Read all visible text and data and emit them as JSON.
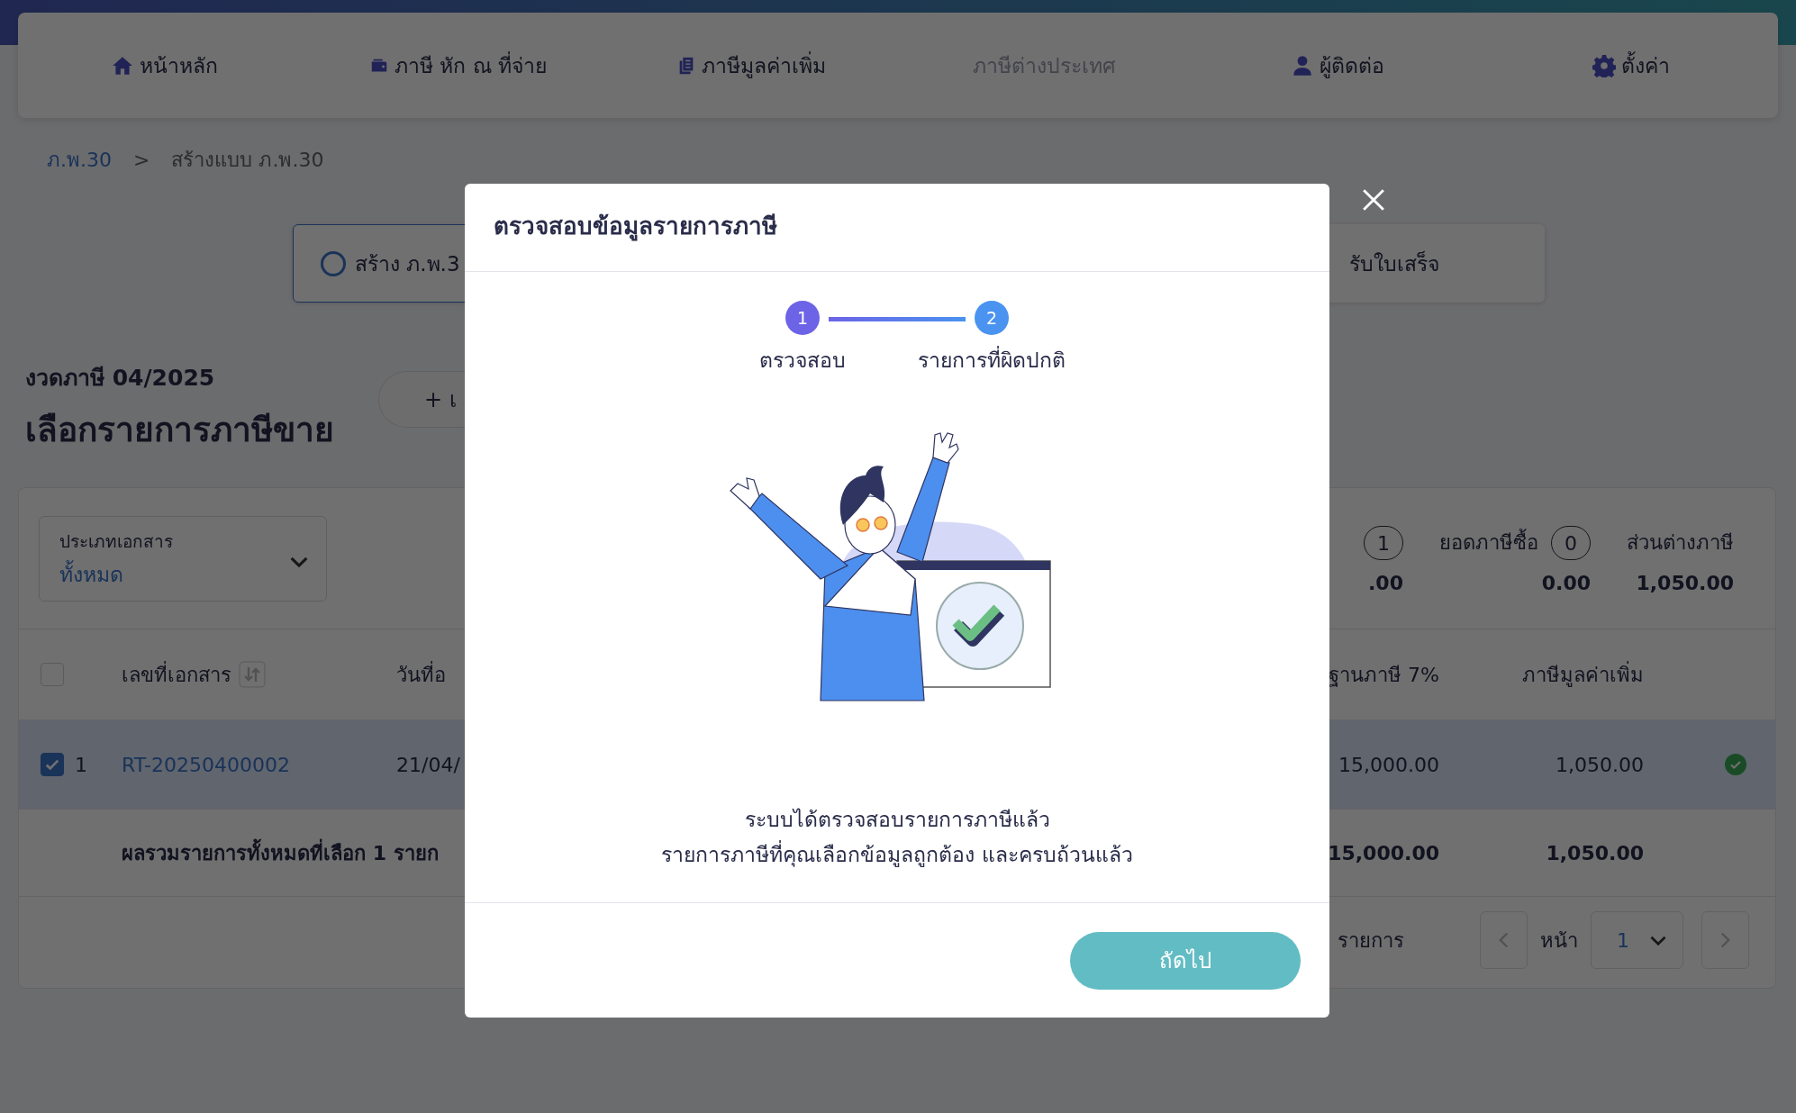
{
  "nav": [
    {
      "label": "หน้าหลัก",
      "disabled": false
    },
    {
      "label": "ภาษี หัก ณ ที่จ่าย",
      "disabled": false
    },
    {
      "label": "ภาษีมูลค่าเพิ่ม",
      "disabled": false
    },
    {
      "label": "ภาษีต่างประเทศ",
      "disabled": true
    },
    {
      "label": "ผู้ติดต่อ",
      "disabled": false
    },
    {
      "label": "ตั้งค่า",
      "disabled": false
    }
  ],
  "breadcrumb": {
    "link": "ภ.พ.30",
    "separator": ">",
    "current": "สร้างแบบ ภ.พ.30"
  },
  "progress_steps": [
    {
      "label": "สร้าง ภ.พ.3",
      "selected": true
    },
    {
      "label": "รับใบเสร็จ",
      "selected": false
    }
  ],
  "period": "งวดภาษี 04/2025",
  "heading": "เลือกรายการภาษีขาย",
  "add_button": "+ เ",
  "filter": {
    "label": "ประเภทเอกสาร",
    "value": "ทั้งหมด"
  },
  "summary": [
    {
      "badge": "1",
      "amount": ".00"
    },
    {
      "label": "ยอดภาษีซื้อ",
      "badge": "0",
      "amount": "0.00"
    },
    {
      "label": "ส่วนต่างภาษี",
      "amount": "1,050.00"
    }
  ],
  "table": {
    "header_checked": false,
    "columns": [
      "เลขที่เอกสาร",
      "วันที่อ",
      "ฐานภาษี 7%",
      "ภาษีมูลค่าเพิ่ม"
    ],
    "rows": [
      {
        "selected": true,
        "checked": true,
        "index": "1",
        "doc_no": "RT-20250400002",
        "date": "21/04/",
        "base": "15,000.00",
        "vat": "1,050.00",
        "valid": true
      }
    ],
    "total": {
      "label": "ผลรวมรายการทั้งหมดที่เลือก 1 รายก",
      "base": "15,000.00",
      "vat": "1,050.00"
    }
  },
  "pagination": {
    "items_label": "รายการ",
    "page_label": "หน้า",
    "page": "1"
  },
  "dialog": {
    "title": "ตรวจสอบข้อมูลรายการภาษี",
    "steps": [
      {
        "number": "1",
        "label": "ตรวจสอบ",
        "color": "#6c63e6"
      },
      {
        "number": "2",
        "label": "รายการที่ผิดปกติ",
        "color": "#4a93f0"
      }
    ],
    "message": [
      "ระบบได้ตรวจสอบรายการภาษีแล้ว",
      "รายการภาษีที่คุณเลือกข้อมูลถูกต้อง และครบถ้วนแล้ว"
    ],
    "next_button": "ถัดไป"
  }
}
